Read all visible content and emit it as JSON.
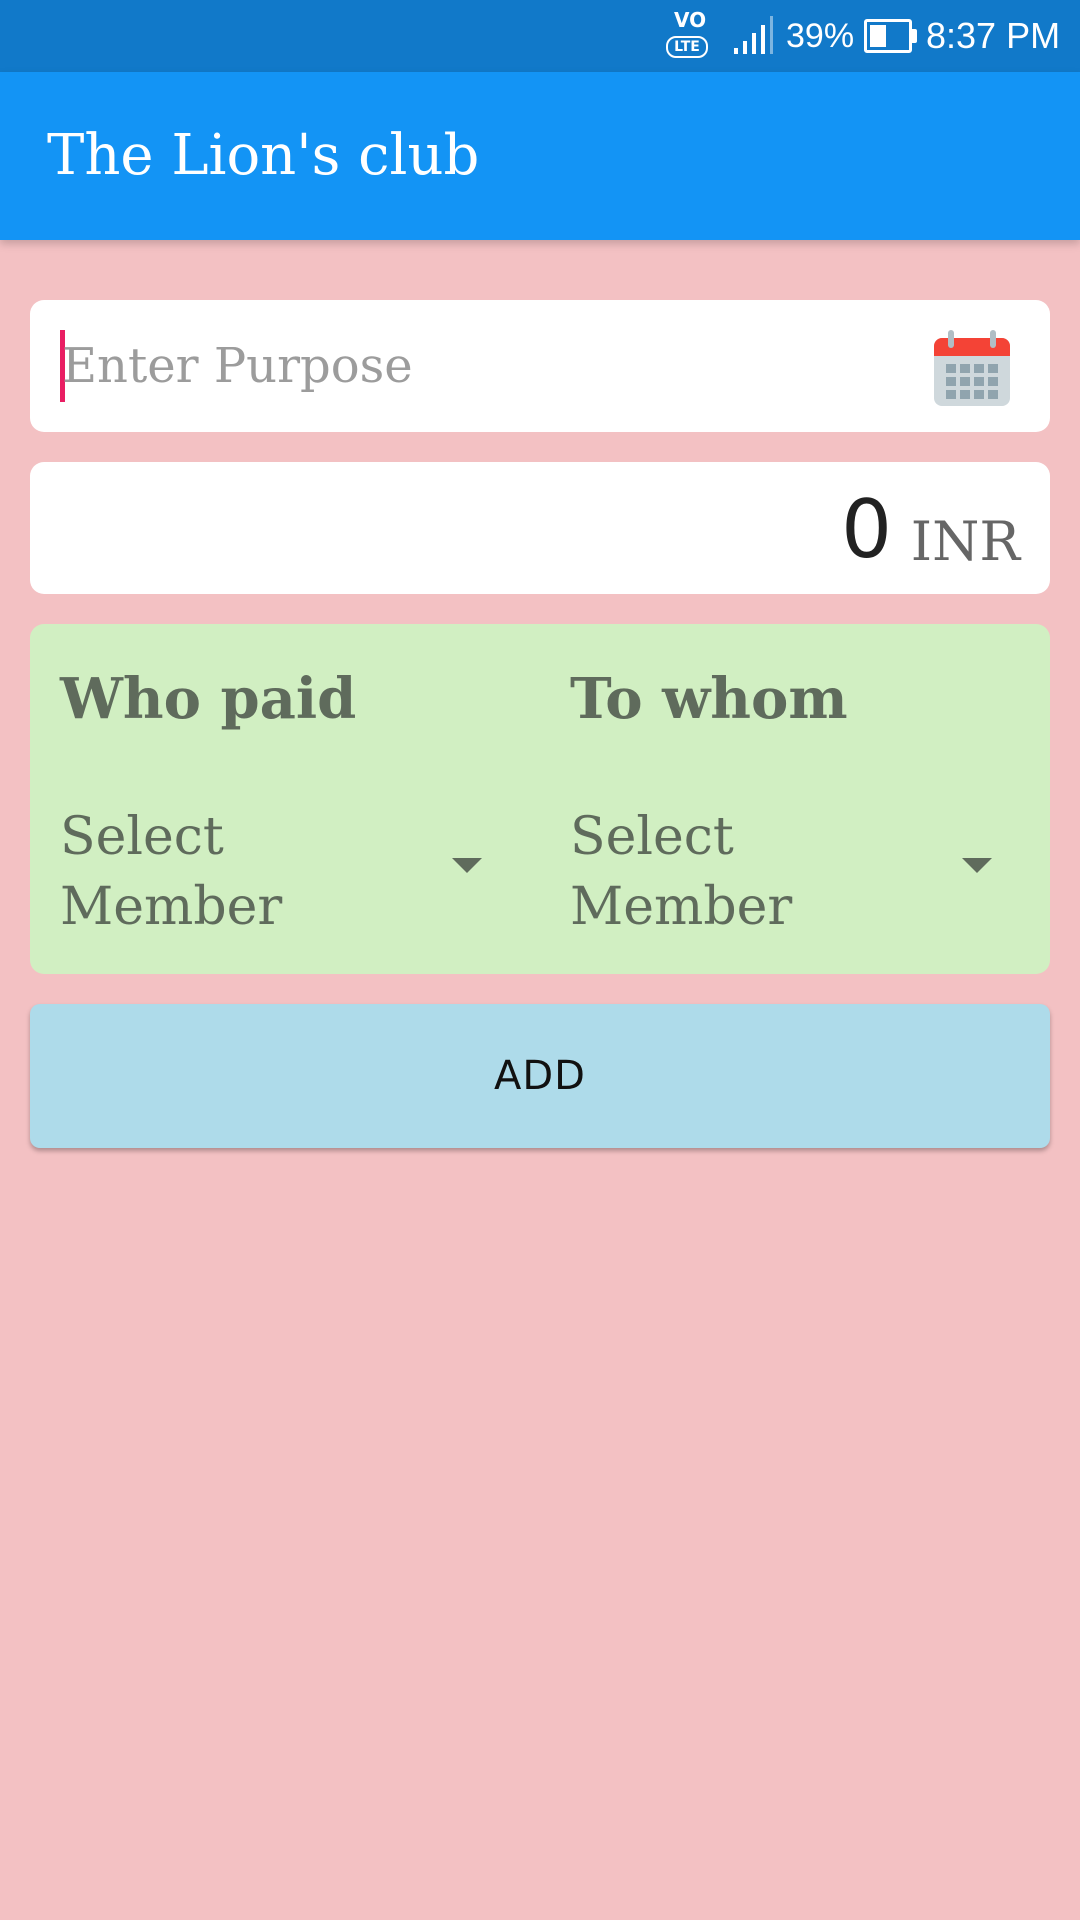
{
  "status_bar": {
    "network_icon": "volte-icon",
    "volte_top": "VO",
    "volte_bottom": "LTE",
    "signal_icon": "signal-icon",
    "battery_percent": "39%",
    "battery_level": 0.39,
    "battery_icon": "battery-icon",
    "time": "8:37 PM"
  },
  "app_bar": {
    "title": "The Lion's club",
    "color": "#1394f5"
  },
  "purpose": {
    "placeholder": "Enter Purpose",
    "value": "",
    "icon": "calendar-icon"
  },
  "amount": {
    "value": "0",
    "currency": "INR"
  },
  "payment": {
    "who_paid": {
      "title": "Who paid",
      "selected": "Select Member",
      "icon": "chevron-down-icon"
    },
    "to_whom": {
      "title": "To whom",
      "selected": "Select Member",
      "icon": "chevron-down-icon"
    },
    "background": "#d1efc2"
  },
  "add_button": {
    "label": "ADD",
    "color": "#aedbea"
  },
  "colors": {
    "page_background": "#f3c1c3",
    "status_bar": "#1179c9",
    "cursor": "#e91e63"
  }
}
